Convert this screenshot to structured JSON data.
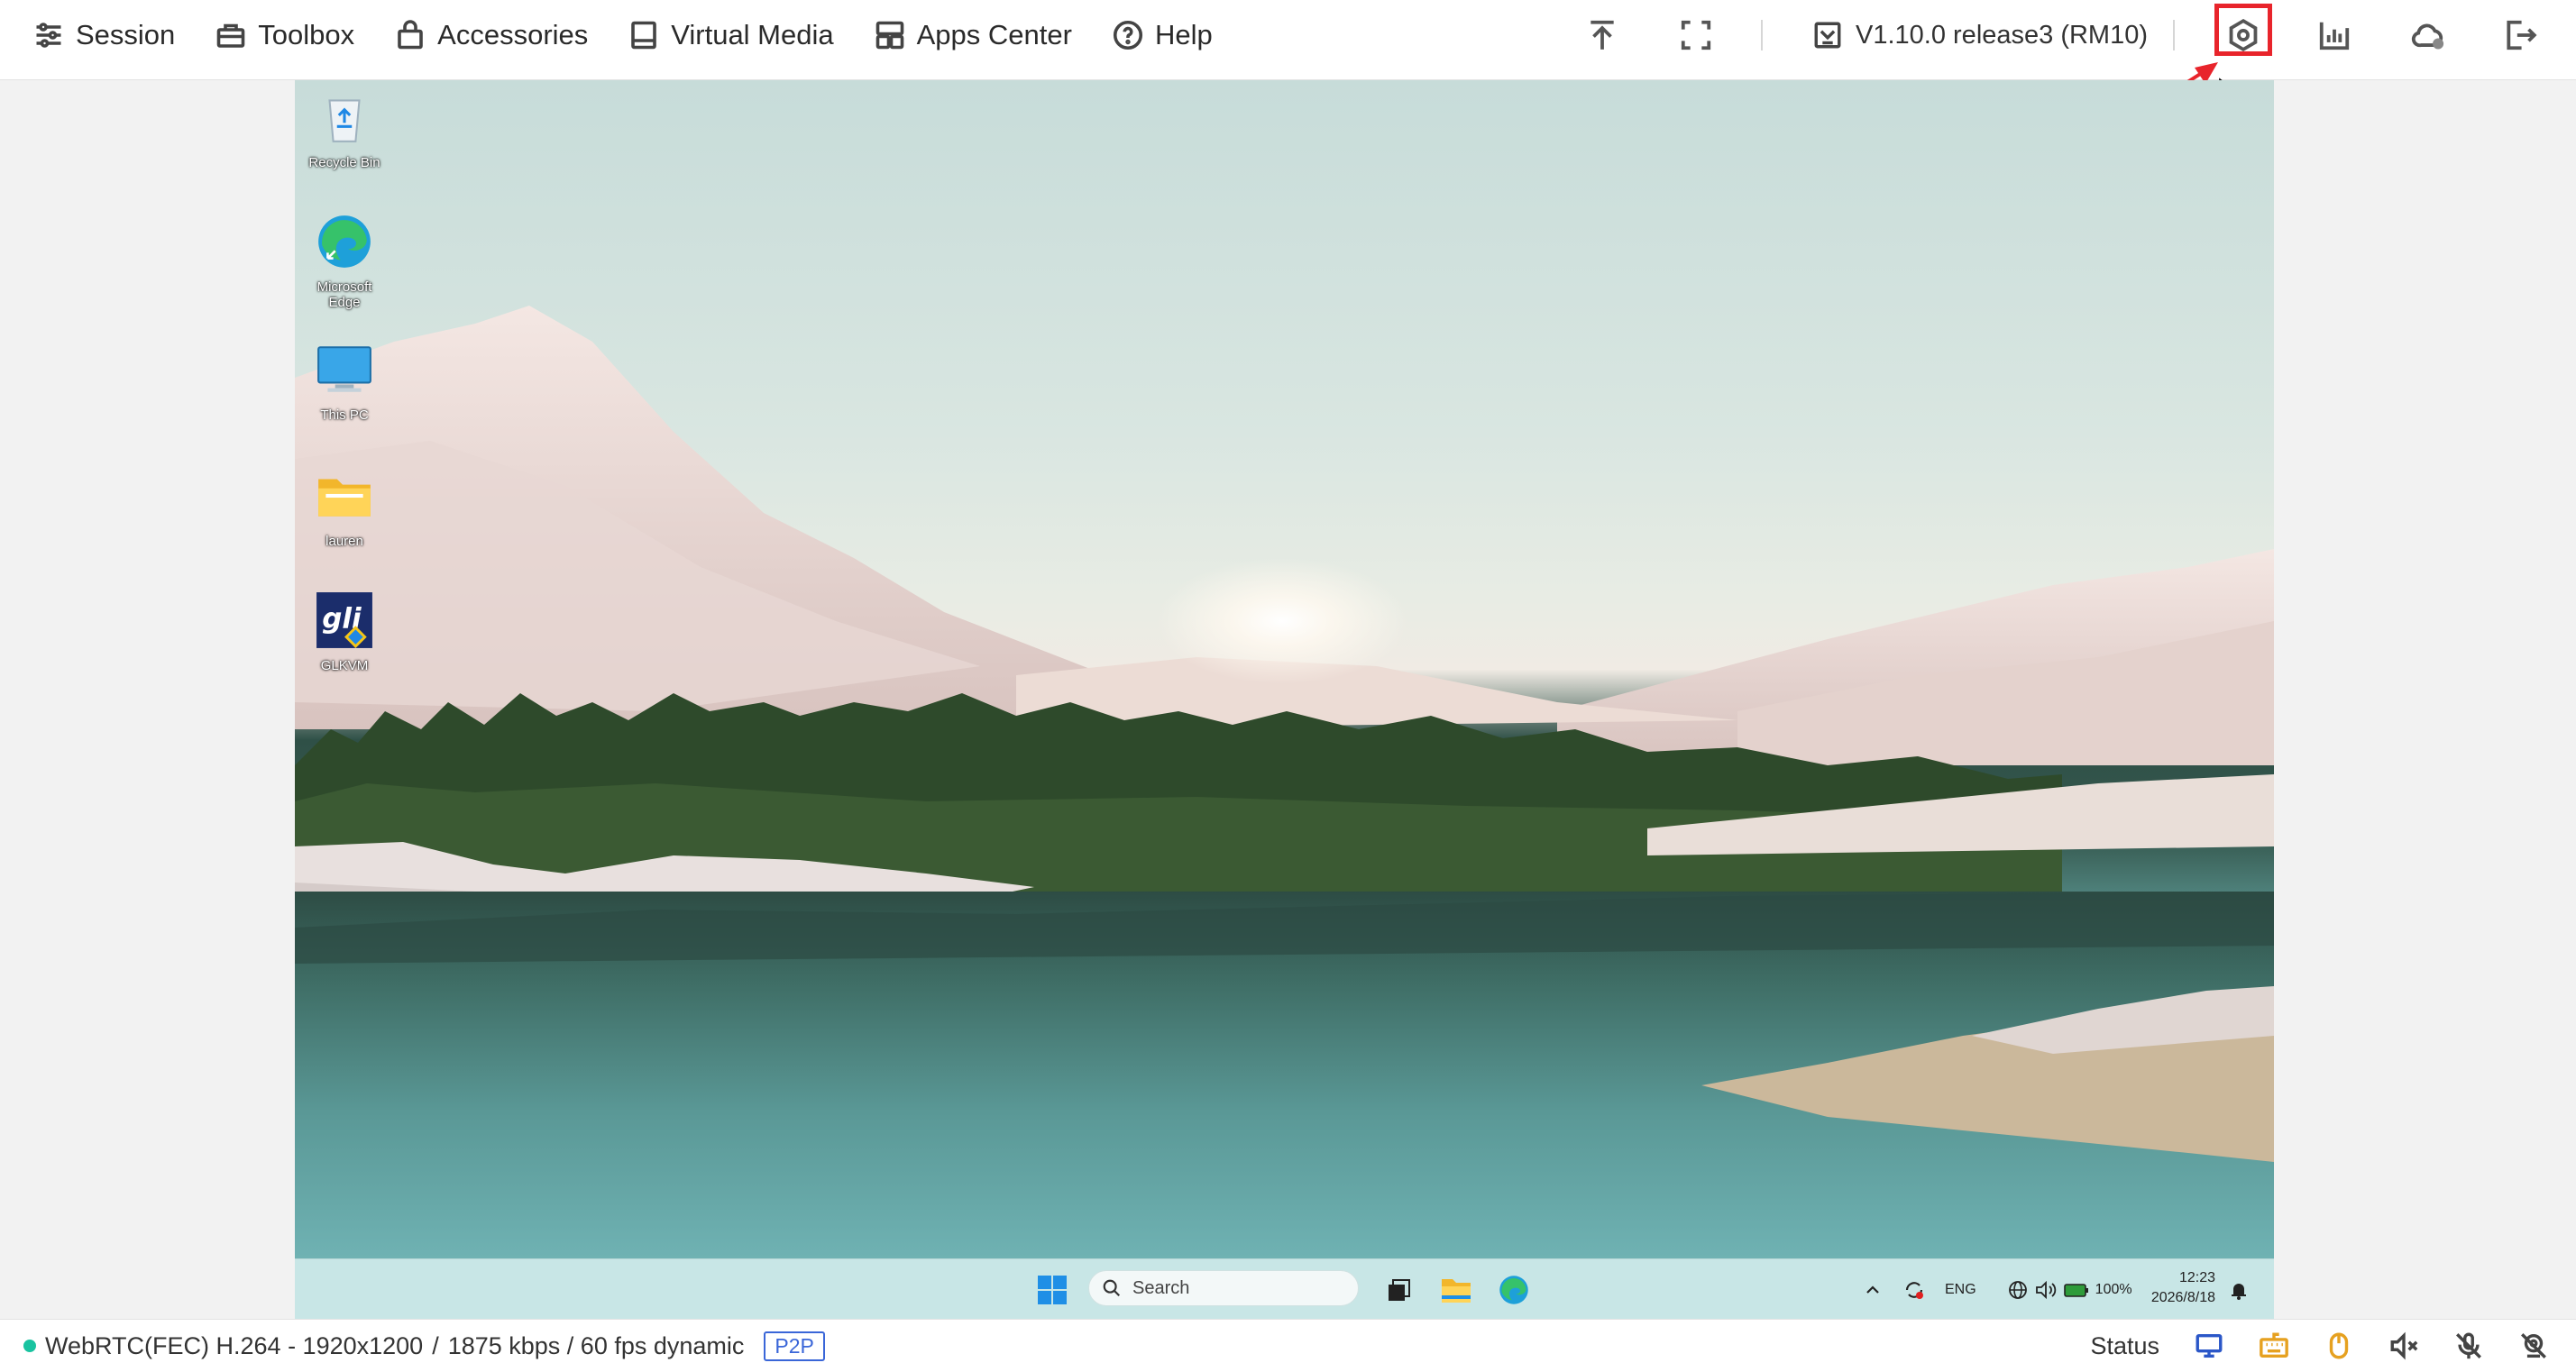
{
  "menu": {
    "items": [
      {
        "label": "Session",
        "icon": "sliders-icon"
      },
      {
        "label": "Toolbox",
        "icon": "toolbox-icon"
      },
      {
        "label": "Accessories",
        "icon": "bag-icon"
      },
      {
        "label": "Virtual Media",
        "icon": "drive-icon"
      },
      {
        "label": "Apps Center",
        "icon": "apps-icon"
      },
      {
        "label": "Help",
        "icon": "help-circle-icon"
      }
    ]
  },
  "toolbar": {
    "version_label": "V1.10.0 release3 (RM10)"
  },
  "desktop": {
    "icons": [
      {
        "label": "Recycle Bin"
      },
      {
        "label": "Microsoft Edge"
      },
      {
        "label": "This PC"
      },
      {
        "label": "lauren"
      },
      {
        "label": "GLKVM"
      }
    ],
    "taskbar": {
      "search_placeholder": "Search",
      "language": "ENG",
      "battery": "100%",
      "time": "12:23",
      "date": "2026/8/18"
    }
  },
  "statusbar": {
    "stream_info": "WebRTC(FEC) H.264 - 1920x1200",
    "bitrate_info": "1875 kbps / 60 fps dynamic",
    "connection_mode": "P2P",
    "status_label": "Status",
    "accent_color": "#19c3a0",
    "highlight_color": "#e8242b"
  }
}
